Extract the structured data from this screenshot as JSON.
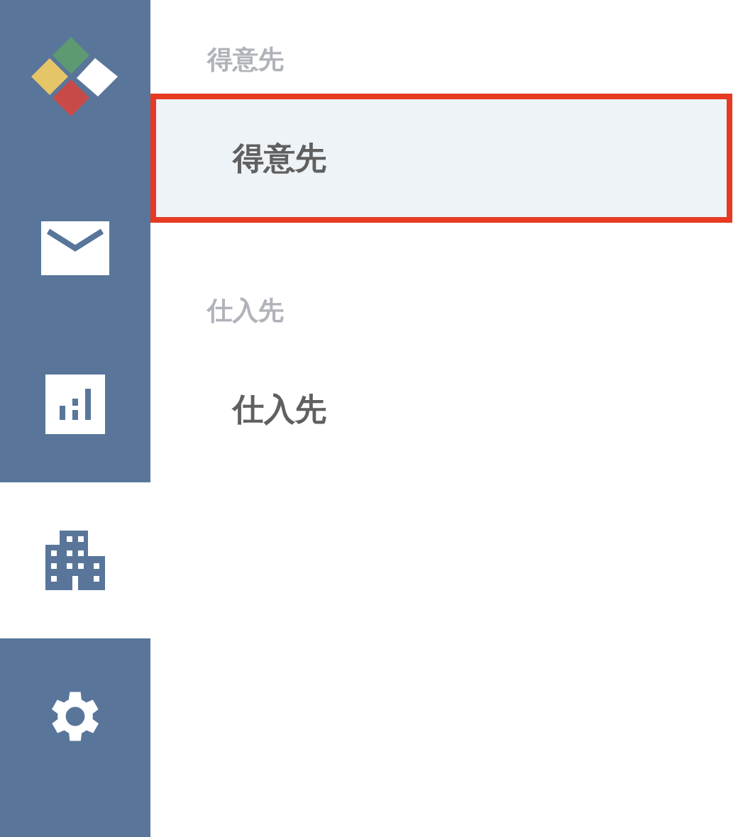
{
  "nav": [
    {
      "kind": "mail",
      "selected": false
    },
    {
      "kind": "chart",
      "selected": false
    },
    {
      "kind": "building",
      "selected": true
    },
    {
      "kind": "settings",
      "selected": false
    }
  ],
  "sections": [
    {
      "heading": "得意先",
      "items": [
        {
          "label": "得意先",
          "selected": true
        }
      ]
    },
    {
      "heading": "仕入先",
      "items": [
        {
          "label": "仕入先",
          "selected": false
        }
      ]
    }
  ]
}
